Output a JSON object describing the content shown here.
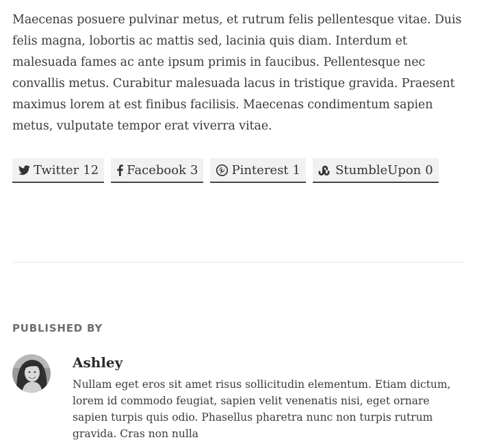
{
  "post": {
    "body": "Maecenas posuere pulvinar metus, et rutrum felis pellentesque vitae. Duis felis magna, lobortis ac mattis sed, lacinia quis diam. Interdum et malesuada fames ac ante ipsum primis in faucibus. Pellentesque nec convallis metus. Curabitur malesuada lacus in tristique gravida. Praesent maximus lorem at est finibus facilisis. Maecenas condimentum sapien metus, vulputate tempor erat viverra vitae."
  },
  "share": {
    "buttons": [
      {
        "label": "Twitter",
        "count": "12",
        "icon": "twitter-icon"
      },
      {
        "label": "Facebook",
        "count": "3",
        "icon": "facebook-icon"
      },
      {
        "label": "Pinterest",
        "count": "1",
        "icon": "pinterest-icon"
      },
      {
        "label": "StumbleUpon",
        "count": "0",
        "icon": "stumbleupon-icon"
      }
    ]
  },
  "author": {
    "published_label": "PUBLISHED BY",
    "name": "Ashley",
    "bio": "Nullam eget eros sit amet risus sollicitudin elementum. Etiam dictum, lorem id commodo feugiat, sapien velit venenatis nisi, eget ornare sapien turpis quis odio. Phasellus pharetra nunc non turpis rutrum gravida. Cras non nulla"
  }
}
